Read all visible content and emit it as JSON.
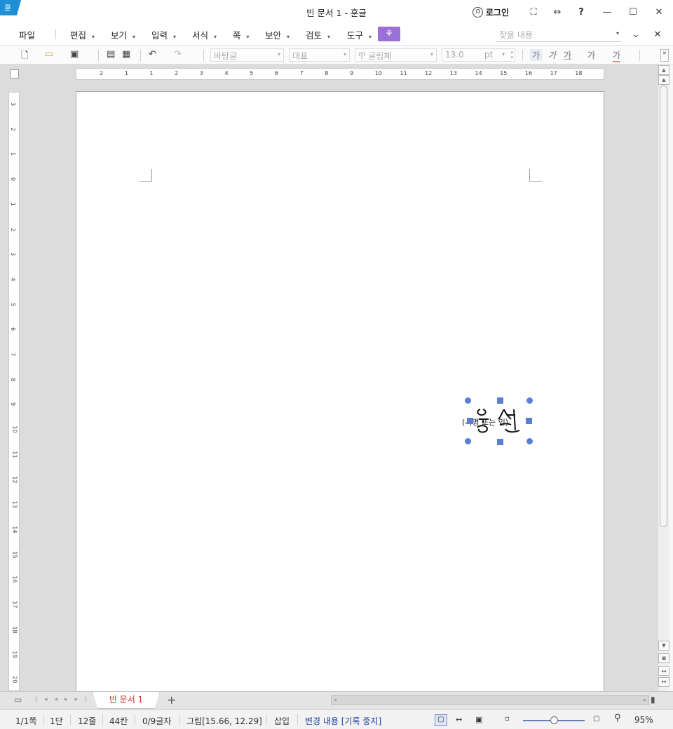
{
  "window": {
    "app_logo": "훈",
    "title": "빈 문서 1 - 훈글",
    "login_label": "로그인",
    "buttons": {
      "fullscreen": "⛶",
      "layout": "⇔",
      "help": "?",
      "minimize": "—",
      "maximize": "☐",
      "close": "✕"
    }
  },
  "menubar": {
    "file": "파일",
    "items": [
      "편집",
      "보기",
      "입력",
      "서식",
      "쪽",
      "보안",
      "검토",
      "도구"
    ],
    "find_placeholder": "찾을 내용",
    "collapse": "⌄",
    "close": "✕"
  },
  "toolbar": {
    "style": "바탕글",
    "lang": "대표",
    "font": "굴림체",
    "size": "13.0",
    "size_unit": "pt",
    "format_buttons": [
      "가",
      "가",
      "가",
      "가",
      "가"
    ]
  },
  "rulers": {
    "h_ticks": [
      "2",
      "1",
      "1",
      "2",
      "3",
      "4",
      "5",
      "6",
      "7",
      "8",
      "9",
      "10",
      "11",
      "12",
      "13",
      "14",
      "15",
      "16",
      "17",
      "18"
    ],
    "v_ticks": [
      "3",
      "2",
      "1",
      "0",
      "1",
      "2",
      "3",
      "4",
      "5",
      "6",
      "7",
      "8",
      "9",
      "10",
      "11",
      "12",
      "13",
      "14",
      "15",
      "16",
      "17",
      "18",
      "19",
      "20"
    ]
  },
  "document": {
    "signature_text": "(서명 또는 인)"
  },
  "tabbar": {
    "tab_label": "빈 문서 1",
    "add": "+"
  },
  "statusbar": {
    "page": "1/1쪽",
    "column": "1단",
    "line": "12줄",
    "char": "44칸",
    "chars": "0/9글자",
    "object": "그림[15.66, 12.29]",
    "mode": "삽입",
    "track": "변경 내용 [기록 중지]",
    "zoom": "95%",
    "zoom_fraction": 0.5
  }
}
